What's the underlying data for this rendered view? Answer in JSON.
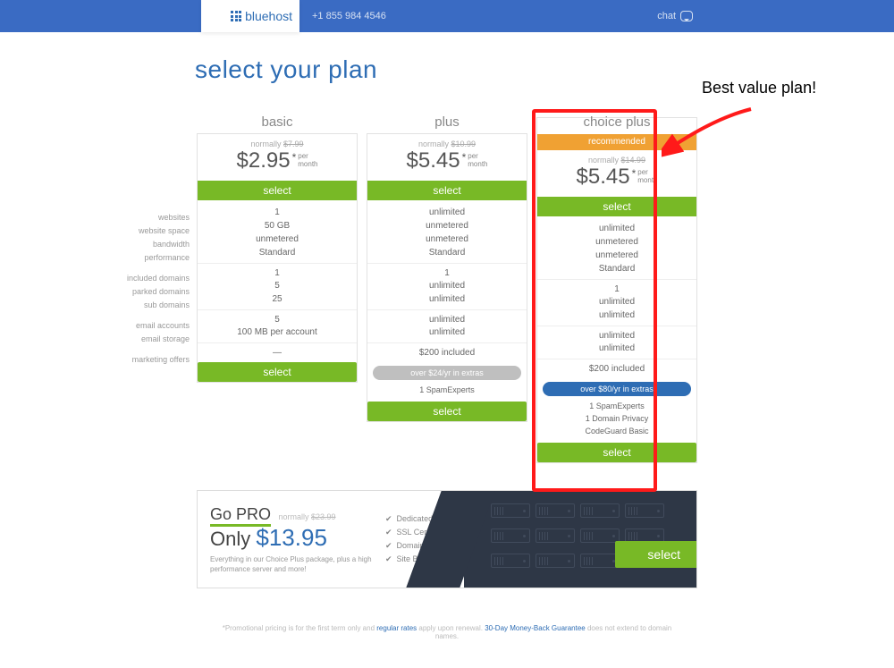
{
  "header": {
    "brand": "bluehost",
    "phone": "+1 855 984 4546",
    "chat": "chat"
  },
  "title": "select your plan",
  "callout": "Best value plan!",
  "feature_labels": {
    "websites": "websites",
    "website_space": "website space",
    "bandwidth": "bandwidth",
    "performance": "performance",
    "included_domains": "included domains",
    "parked_domains": "parked domains",
    "sub_domains": "sub domains",
    "email_accounts": "email accounts",
    "email_storage": "email storage",
    "marketing_offers": "marketing offers"
  },
  "common": {
    "normally": "normally",
    "select": "select",
    "per": "per",
    "month": "month"
  },
  "plans": {
    "basic": {
      "name": "basic",
      "old_price": "$7.99",
      "price": "$2.95",
      "f": {
        "websites": "1",
        "website_space": "50 GB",
        "bandwidth": "unmetered",
        "performance": "Standard",
        "included_domains": "1",
        "parked_domains": "5",
        "sub_domains": "25",
        "email_accounts": "5",
        "email_storage": "100 MB per account",
        "marketing_offers": "—"
      }
    },
    "plus": {
      "name": "plus",
      "old_price": "$10.99",
      "price": "$5.45",
      "f": {
        "websites": "unlimited",
        "website_space": "unmetered",
        "bandwidth": "unmetered",
        "performance": "Standard",
        "included_domains": "1",
        "parked_domains": "unlimited",
        "sub_domains": "unlimited",
        "email_accounts": "unlimited",
        "email_storage": "unlimited",
        "marketing_offers": "$200 included"
      },
      "extras_pill": "over $24/yr in extras",
      "extras": {
        "e1": "1 SpamExperts"
      }
    },
    "choice": {
      "name": "choice plus",
      "recommended": "recommended",
      "old_price": "$14.99",
      "price": "$5.45",
      "f": {
        "websites": "unlimited",
        "website_space": "unmetered",
        "bandwidth": "unmetered",
        "performance": "Standard",
        "included_domains": "1",
        "parked_domains": "unlimited",
        "sub_domains": "unlimited",
        "email_accounts": "unlimited",
        "email_storage": "unlimited",
        "marketing_offers": "$200 included"
      },
      "extras_pill": "over $80/yr in extras",
      "extras": {
        "e1": "1 SpamExperts",
        "e2": "1 Domain Privacy",
        "e3": "CodeGuard Basic"
      }
    }
  },
  "gopro": {
    "title": "Go PRO",
    "normally": "normally",
    "old_price": "$23.99",
    "only": "Only",
    "price": "$13.95",
    "desc": "Everything in our Choice Plus package, plus a high performance server and more!",
    "features": {
      "f1": "Dedicated IP",
      "f2": "SSL Certificate",
      "f3": "Domain Privacy",
      "f4": "Site Backup"
    },
    "select": "select"
  },
  "footnote": {
    "p1": "*Promotional pricing is for the first term only and ",
    "link1": "regular rates",
    "p2": " apply upon renewal. ",
    "link2": "30-Day Money-Back Guarantee",
    "p3": " does not extend to domain names."
  }
}
